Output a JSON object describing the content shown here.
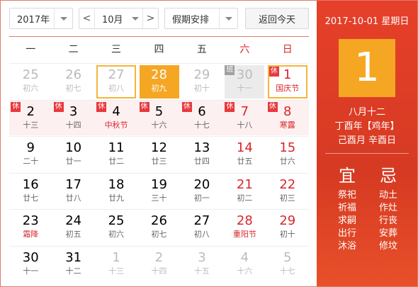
{
  "toolbar": {
    "year_value": "2017年",
    "month_value": "10月",
    "holiday_value": "假期安排",
    "today_label": "返回今天",
    "prev_arrow": "<",
    "next_arrow": ">"
  },
  "weekdays": [
    "一",
    "二",
    "三",
    "四",
    "五",
    "六",
    "日"
  ],
  "weeks": [
    [
      {
        "day": "25",
        "lunar": "初六",
        "out": true
      },
      {
        "day": "26",
        "lunar": "初七",
        "out": true
      },
      {
        "day": "27",
        "lunar": "初八",
        "out": true,
        "sel": true
      },
      {
        "day": "28",
        "lunar": "初九",
        "out": true,
        "today": true
      },
      {
        "day": "29",
        "lunar": "初十",
        "out": true
      },
      {
        "day": "30",
        "lunar": "十一",
        "out": true,
        "grey": true,
        "badge": "班",
        "badgeType": "ban"
      },
      {
        "day": "1",
        "lunar": "国庆节",
        "fest": true,
        "we": true,
        "sel": true,
        "badge": "休"
      }
    ],
    [
      {
        "day": "2",
        "lunar": "十三",
        "badge": "休"
      },
      {
        "day": "3",
        "lunar": "十四",
        "badge": "休"
      },
      {
        "day": "4",
        "lunar": "中秋节",
        "fest": true,
        "badge": "休"
      },
      {
        "day": "5",
        "lunar": "十六",
        "badge": "休"
      },
      {
        "day": "6",
        "lunar": "十七",
        "badge": "休"
      },
      {
        "day": "7",
        "lunar": "十八",
        "we": true,
        "badge": "休"
      },
      {
        "day": "8",
        "lunar": "寒露",
        "fest": true,
        "we": true,
        "badge": "休"
      }
    ],
    [
      {
        "day": "9",
        "lunar": "二十"
      },
      {
        "day": "10",
        "lunar": "廿一"
      },
      {
        "day": "11",
        "lunar": "廿二"
      },
      {
        "day": "12",
        "lunar": "廿三"
      },
      {
        "day": "13",
        "lunar": "廿四"
      },
      {
        "day": "14",
        "lunar": "廿五",
        "we": true
      },
      {
        "day": "15",
        "lunar": "廿六",
        "we": true
      }
    ],
    [
      {
        "day": "16",
        "lunar": "廿七"
      },
      {
        "day": "17",
        "lunar": "廿八"
      },
      {
        "day": "18",
        "lunar": "廿九"
      },
      {
        "day": "19",
        "lunar": "三十"
      },
      {
        "day": "20",
        "lunar": "初一"
      },
      {
        "day": "21",
        "lunar": "初二",
        "we": true
      },
      {
        "day": "22",
        "lunar": "初三",
        "we": true
      }
    ],
    [
      {
        "day": "23",
        "lunar": "霜降",
        "fest": true
      },
      {
        "day": "24",
        "lunar": "初五"
      },
      {
        "day": "25",
        "lunar": "初六"
      },
      {
        "day": "26",
        "lunar": "初七"
      },
      {
        "day": "27",
        "lunar": "初八"
      },
      {
        "day": "28",
        "lunar": "重阳节",
        "fest": true,
        "we": true
      },
      {
        "day": "29",
        "lunar": "初十",
        "we": true
      }
    ],
    [
      {
        "day": "30",
        "lunar": "十一"
      },
      {
        "day": "31",
        "lunar": "十二"
      },
      {
        "day": "1",
        "lunar": "十三",
        "out": true
      },
      {
        "day": "2",
        "lunar": "十四",
        "out": true
      },
      {
        "day": "3",
        "lunar": "十五",
        "out": true
      },
      {
        "day": "4",
        "lunar": "十六",
        "out": true
      },
      {
        "day": "5",
        "lunar": "十七",
        "out": true
      }
    ]
  ],
  "panel": {
    "date_line": "2017-10-01 星期日",
    "big_day": "1",
    "lunar_md": "八月十二",
    "lunar_year": "丁酉年【鸡年】",
    "ganzhi": "己酉月 辛酉日",
    "yi_title": "宜",
    "ji_title": "忌",
    "yi_items": [
      "祭祀",
      "祈福",
      "求嗣",
      "出行",
      "沐浴"
    ],
    "ji_items": [
      "动土",
      "作灶",
      "行丧",
      "安葬",
      "修坟"
    ]
  },
  "colors": {
    "accent": "#e6402a",
    "today": "#f5a623",
    "holiday_badge": "#e8383d",
    "weekend_text": "#d9262c"
  }
}
